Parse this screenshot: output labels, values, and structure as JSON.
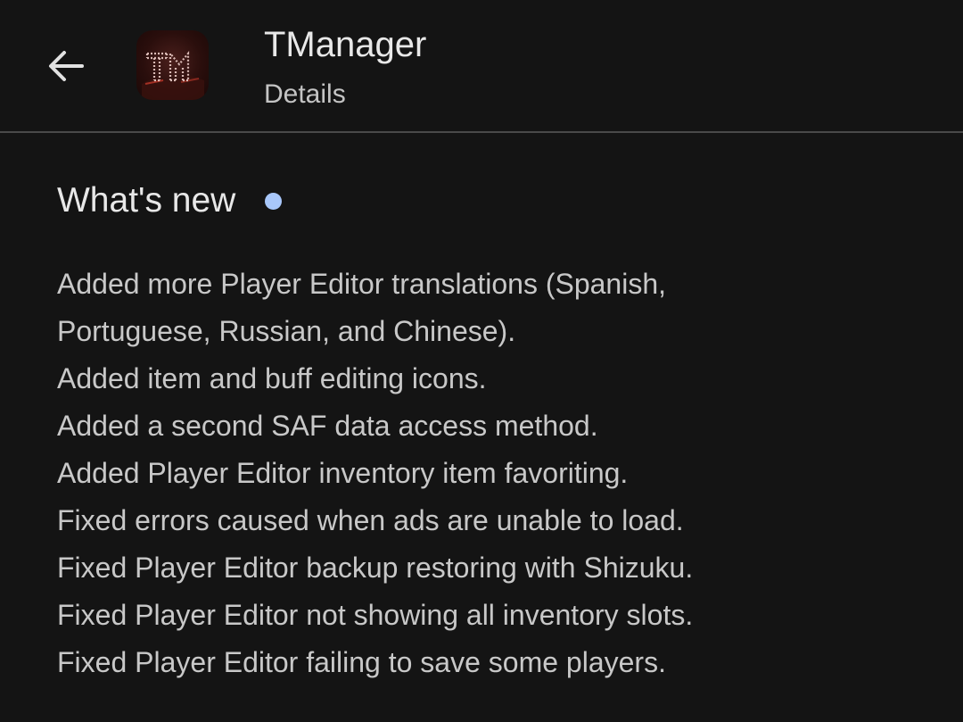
{
  "header": {
    "back_icon": "arrow-left-icon",
    "app_icon": "tmanager-app-icon",
    "app_icon_letters": "TM",
    "app_name": "TManager",
    "subtitle": "Details"
  },
  "whats_new": {
    "title": "What's new",
    "dot_color": "#a8c7fa",
    "lines": [
      "Added more Player Editor translations (Spanish,",
      "Portuguese, Russian, and Chinese).",
      "Added item and buff editing icons.",
      "Added a second SAF data access method.",
      "Added Player Editor inventory item favoriting.",
      "Fixed errors caused when ads are unable to load.",
      "Fixed Player Editor backup restoring with Shizuku.",
      "Fixed Player Editor not showing all inventory slots.",
      "Fixed Player Editor failing to save some players."
    ]
  }
}
